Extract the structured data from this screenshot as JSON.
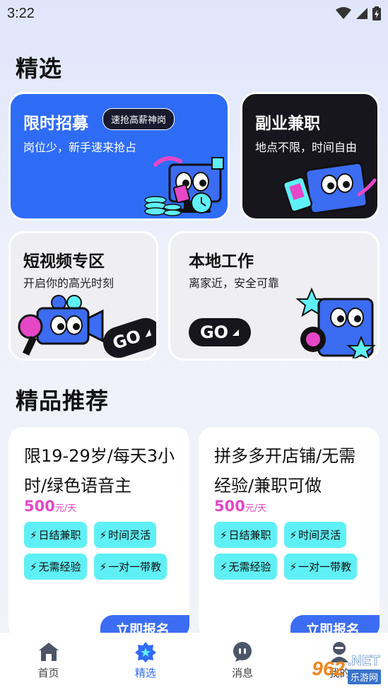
{
  "status_bar": {
    "time": "3:22",
    "icons": [
      "wifi-icon",
      "signal-icon",
      "battery-icon"
    ]
  },
  "featured": {
    "title": "精选",
    "cards": [
      {
        "title": "限时招募",
        "tag": "速抢高薪神岗",
        "subtitle": "岗位少，新手速来抢占"
      },
      {
        "title": "副业兼职",
        "subtitle": "地点不限，时间自由"
      },
      {
        "title": "短视频专区",
        "subtitle": "开启你的高光时刻",
        "button": "GO"
      },
      {
        "title": "本地工作",
        "subtitle": "离家近，安全可靠",
        "button": "GO"
      }
    ]
  },
  "recommend": {
    "title": "精品推荐",
    "items": [
      {
        "title": "限19-29岁/每天3小时/绿色语音主",
        "price": "500",
        "price_unit": "元/天",
        "tags": [
          "日结兼职",
          "时间灵活",
          "无需经验",
          "一对一带教"
        ],
        "button": "立即报名"
      },
      {
        "title": "拼多多开店铺/无需经验/兼职可做",
        "price": "500",
        "price_unit": "元/天",
        "tags": [
          "日结兼职",
          "时间灵活",
          "无需经验",
          "一对一带教"
        ],
        "button": "立即报名"
      }
    ]
  },
  "bottom_nav": [
    {
      "label": "首页",
      "icon": "home-icon"
    },
    {
      "label": "精选",
      "icon": "featured-icon",
      "active": true
    },
    {
      "label": "消息",
      "icon": "message-icon"
    },
    {
      "label": "我的",
      "icon": "profile-icon"
    }
  ],
  "watermark": {
    "number": "962",
    "suffix": ".NET",
    "site": "乐游网"
  },
  "colors": {
    "accent": "#2f6cf6",
    "price": "#e547c7",
    "tag": "#5ff0f5",
    "dark_card": "#16161c"
  }
}
